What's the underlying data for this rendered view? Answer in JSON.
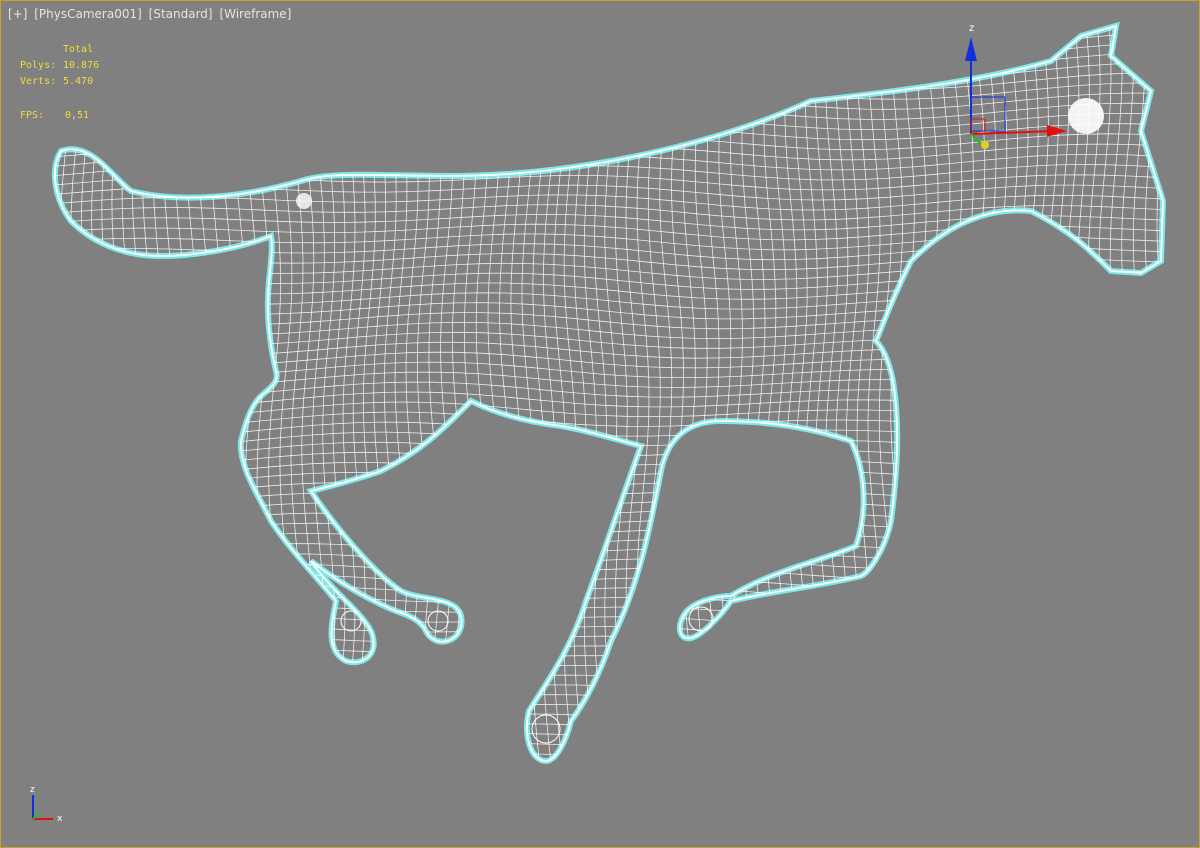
{
  "viewport": {
    "labels": [
      "[+]",
      "[PhysCamera001]",
      "[Standard]",
      "[Wireframe]"
    ],
    "border_color": "#c9a227",
    "background_color": "#808080"
  },
  "stats": {
    "header": "Total",
    "polys_label": "Polys:",
    "polys_value": "10.876",
    "verts_label": "Verts:",
    "verts_value": "5.470",
    "fps_label": "FPS:",
    "fps_value": "0,51",
    "color": "#f0dc3c"
  },
  "gizmo": {
    "z_label": "z",
    "x_color": "#e01010",
    "y_color": "#22c022",
    "z_color": "#1030e0"
  },
  "corner_axes": {
    "z_label": "z",
    "x_label": "x"
  },
  "model": {
    "icon": "horse-wireframe-mesh",
    "wire_color": "#ffffff",
    "selection_outline_color": "#7fe8e8"
  }
}
